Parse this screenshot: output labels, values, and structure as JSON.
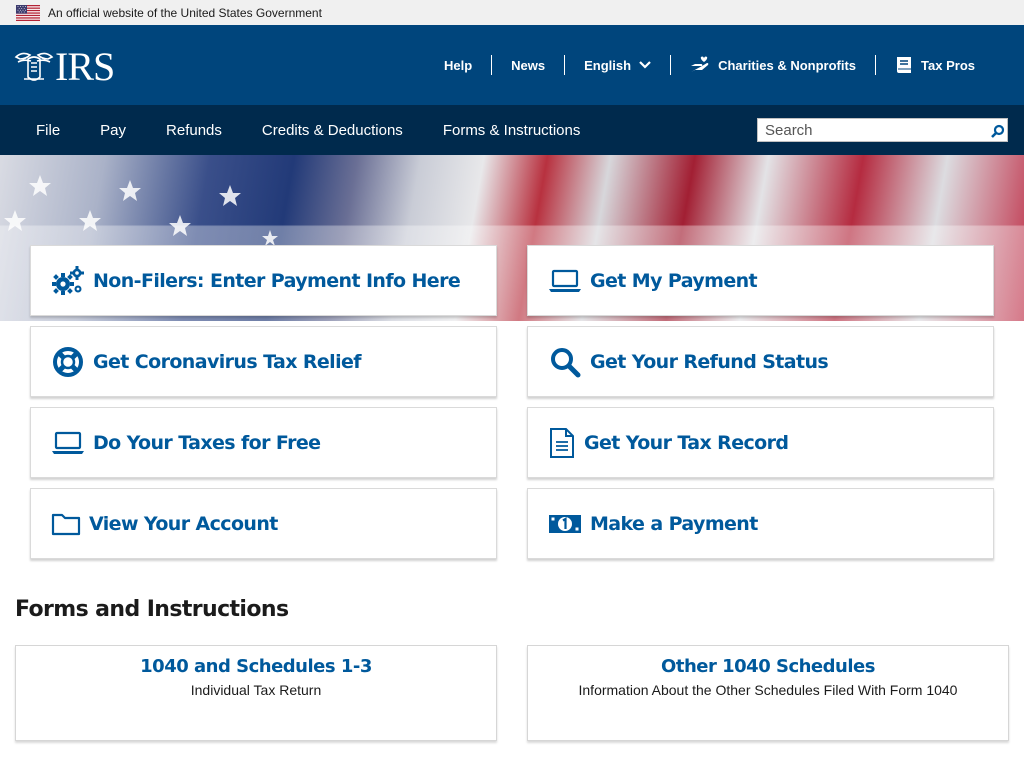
{
  "gov_banner": {
    "text": "An official website of the United States Government"
  },
  "header": {
    "logo_text": "IRS",
    "utility_links": [
      {
        "label": "Help",
        "icon": ""
      },
      {
        "label": "News",
        "icon": ""
      },
      {
        "label": "English",
        "icon": "chevron-down-icon"
      },
      {
        "label": "Charities & Nonprofits",
        "icon": "charity-hand-icon"
      },
      {
        "label": "Tax Pros",
        "icon": "book-icon"
      }
    ]
  },
  "nav": {
    "items": [
      "File",
      "Pay",
      "Refunds",
      "Credits & Deductions",
      "Forms & Instructions"
    ],
    "search_placeholder": "Search"
  },
  "tiles": [
    {
      "label": "Non-Filers: Enter Payment Info Here",
      "icon": "gears-icon"
    },
    {
      "label": "Get My Payment",
      "icon": "laptop-icon"
    },
    {
      "label": "Get Coronavirus Tax Relief",
      "icon": "life-ring-icon"
    },
    {
      "label": "Get Your Refund Status",
      "icon": "search-icon"
    },
    {
      "label": "Do Your Taxes for Free",
      "icon": "laptop-icon"
    },
    {
      "label": "Get Your Tax Record",
      "icon": "document-icon"
    },
    {
      "label": "View Your Account",
      "icon": "folder-icon"
    },
    {
      "label": "Make a Payment",
      "icon": "money-icon"
    }
  ],
  "forms_section": {
    "title": "Forms and Instructions",
    "cards": [
      {
        "title": "1040 and Schedules 1-3",
        "subtitle": "Individual Tax Return"
      },
      {
        "title": "Other 1040 Schedules",
        "subtitle": "Information About the Other Schedules Filed With Form 1040"
      }
    ]
  },
  "colors": {
    "header_bg": "#00457c",
    "nav_bg": "#002a4d",
    "link_blue": "#00599c",
    "banner_bg": "#f0f0f0"
  }
}
